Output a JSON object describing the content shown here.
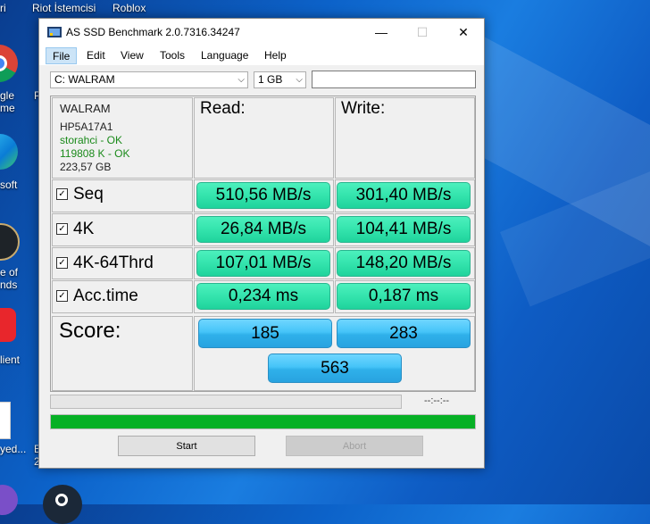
{
  "desktop": {
    "icons": [
      {
        "label": "ri",
        "icon": "app-icon"
      },
      {
        "label": "Riot İstemcisi",
        "icon": "riot-client-icon"
      },
      {
        "label": "Roblox",
        "icon": "roblox-icon"
      },
      {
        "label": "gle",
        "icon": "chrome-icon"
      },
      {
        "label": "me",
        "icon": "chrome-icon"
      },
      {
        "label": "soft",
        "icon": "edge-icon"
      },
      {
        "label": "e of",
        "icon": "league-of-legends-icon"
      },
      {
        "label": "nds",
        "icon": "league-of-legends-icon"
      },
      {
        "label": "lient",
        "icon": "riot-client-icon"
      },
      {
        "label": "yed...",
        "icon": "file-icon"
      },
      {
        "label": "E",
        "icon": "file-icon"
      }
    ]
  },
  "window": {
    "title": "AS SSD Benchmark 2.0.7316.34247",
    "minimize_glyph": "—",
    "maximize_glyph": "☐",
    "close_glyph": "✕"
  },
  "menu": {
    "items": [
      "File",
      "Edit",
      "View",
      "Tools",
      "Language",
      "Help"
    ],
    "active": "File"
  },
  "controls": {
    "drive_select": "C: WALRAM",
    "size_select": "1 GB",
    "text_field": ""
  },
  "drive_info": {
    "name": "WALRAM",
    "model": "HP5A17A1",
    "driver": "storahci - OK",
    "alignment": "119808 K - OK",
    "capacity": "223,57 GB"
  },
  "headers": {
    "read": "Read:",
    "write": "Write:"
  },
  "rows": [
    {
      "label": "Seq",
      "checked": true,
      "read": "510,56 MB/s",
      "write": "301,40 MB/s"
    },
    {
      "label": "4K",
      "checked": true,
      "read": "26,84 MB/s",
      "write": "104,41 MB/s"
    },
    {
      "label": "4K-64Thrd",
      "checked": true,
      "read": "107,01 MB/s",
      "write": "148,20 MB/s"
    },
    {
      "label": "Acc.time",
      "checked": true,
      "read": "0,234 ms",
      "write": "0,187 ms"
    }
  ],
  "score": {
    "label": "Score:",
    "read": "185",
    "write": "283",
    "total": "563"
  },
  "progress": {
    "time": "--:--:--",
    "test_progress": 0,
    "total_progress": 1.0,
    "fill_color": "#06b025"
  },
  "buttons": {
    "start": "Start",
    "abort": "Abort"
  }
}
